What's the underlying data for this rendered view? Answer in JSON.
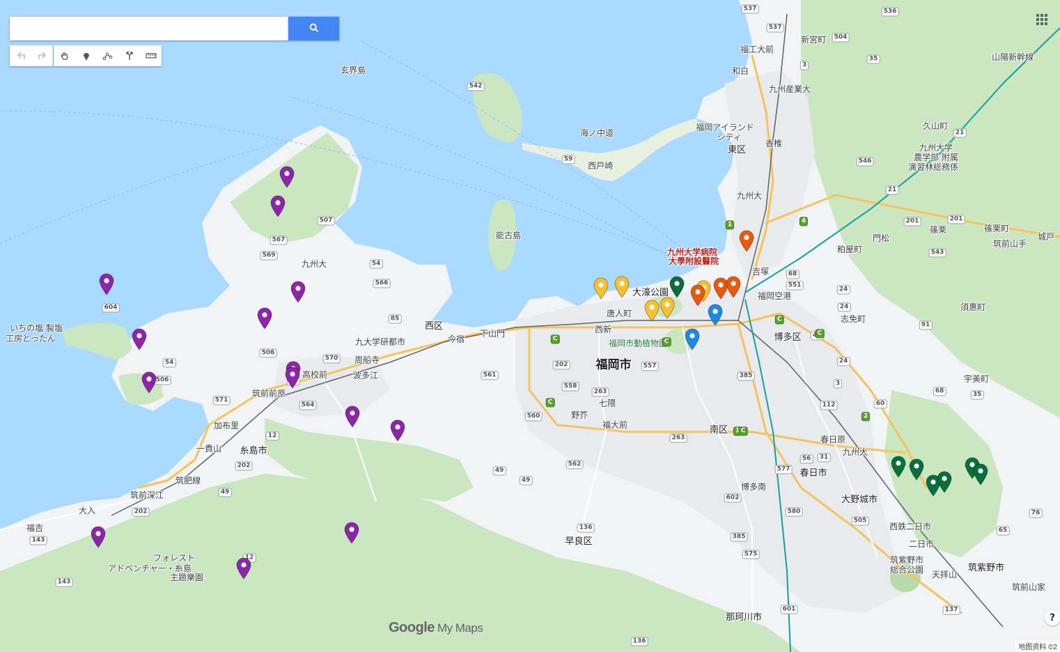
{
  "search": {
    "placeholder": "",
    "value": ""
  },
  "toolbar": {
    "buttons": [
      {
        "id": "undo",
        "icon": "undo-icon"
      },
      {
        "id": "redo",
        "icon": "redo-icon"
      },
      {
        "id": "pan",
        "icon": "hand-icon"
      },
      {
        "id": "marker",
        "icon": "marker-icon"
      },
      {
        "id": "line",
        "icon": "draw-line-icon"
      },
      {
        "id": "directions",
        "icon": "directions-icon"
      },
      {
        "id": "measure",
        "icon": "ruler-icon"
      }
    ]
  },
  "colors": {
    "water": "#aadaff",
    "land": "#f1f3f4",
    "park": "#cbe7c2",
    "forest": "#b8d9a8",
    "purple": "#8e24aa",
    "orange": "#e8590c",
    "yellow": "#fbc02d",
    "green": "#0b6e3d",
    "blue": "#1e88e5",
    "accent": "#4285f4"
  },
  "branding": {
    "google": "Google",
    "mymaps": "My Maps",
    "attribution": "地图资料 ©2"
  },
  "labels": [
    {
      "t": "福岡市",
      "cls": "big"
    },
    {
      "t": "玄界島",
      "cls": ""
    },
    {
      "t": "能古島",
      "cls": ""
    },
    {
      "t": "海ノ中道",
      "cls": ""
    },
    {
      "t": "西戸崎",
      "cls": ""
    },
    {
      "t": "福岡アイランド",
      "cls": ""
    },
    {
      "t": "シティ",
      "cls": ""
    },
    {
      "t": "東区",
      "cls": "mid"
    },
    {
      "t": "香椎",
      "cls": ""
    },
    {
      "t": "新宮町",
      "cls": ""
    },
    {
      "t": "福工大前",
      "cls": ""
    },
    {
      "t": "和白",
      "cls": ""
    },
    {
      "t": "九州産業大",
      "cls": ""
    },
    {
      "t": "九州大",
      "cls": ""
    },
    {
      "t": "九州大学病院",
      "cls": "red"
    },
    {
      "t": "大學附設醫院",
      "cls": "red"
    },
    {
      "t": "吉塚",
      "cls": ""
    },
    {
      "t": "大濠公園",
      "cls": "mid"
    },
    {
      "t": "唐人町",
      "cls": ""
    },
    {
      "t": "西新",
      "cls": ""
    },
    {
      "t": "福岡市動植物園",
      "cls": "green"
    },
    {
      "t": "福岡空港",
      "cls": ""
    },
    {
      "t": "博多区",
      "cls": "mid"
    },
    {
      "t": "粕屋町",
      "cls": ""
    },
    {
      "t": "志免町",
      "cls": ""
    },
    {
      "t": "西区",
      "cls": "mid"
    },
    {
      "t": "九大学研都市",
      "cls": ""
    },
    {
      "t": "今宿",
      "cls": ""
    },
    {
      "t": "下山門",
      "cls": ""
    },
    {
      "t": "周船寺",
      "cls": ""
    },
    {
      "t": "波多江",
      "cls": ""
    },
    {
      "t": "高校前",
      "cls": ""
    },
    {
      "t": "筑前前原",
      "cls": ""
    },
    {
      "t": "加布里",
      "cls": ""
    },
    {
      "t": "一貴山",
      "cls": ""
    },
    {
      "t": "糸島市",
      "cls": "mid"
    },
    {
      "t": "筑肥線",
      "cls": ""
    },
    {
      "t": "筑前深江",
      "cls": ""
    },
    {
      "t": "大入",
      "cls": ""
    },
    {
      "t": "福吉",
      "cls": ""
    },
    {
      "t": "フォレスト",
      "cls": ""
    },
    {
      "t": "アドベンチャー・糸島",
      "cls": ""
    },
    {
      "t": "主題樂園",
      "cls": ""
    },
    {
      "t": "いちの塩 製塩",
      "cls": ""
    },
    {
      "t": "工房とったん",
      "cls": ""
    },
    {
      "t": "七隈",
      "cls": ""
    },
    {
      "t": "野芥",
      "cls": ""
    },
    {
      "t": "福大前",
      "cls": ""
    },
    {
      "t": "南区",
      "cls": "mid"
    },
    {
      "t": "早良区",
      "cls": "mid"
    },
    {
      "t": "博多南",
      "cls": ""
    },
    {
      "t": "春日原",
      "cls": ""
    },
    {
      "t": "春日市",
      "cls": "mid"
    },
    {
      "t": "大野城市",
      "cls": "mid"
    },
    {
      "t": "西鉄二日市",
      "cls": ""
    },
    {
      "t": "二日市",
      "cls": ""
    },
    {
      "t": "筑紫野市",
      "cls": "mid"
    },
    {
      "t": "天拝山",
      "cls": ""
    },
    {
      "t": "筑前山家",
      "cls": ""
    },
    {
      "t": "筑紫野市",
      "cls": ""
    },
    {
      "t": "総合公園",
      "cls": ""
    },
    {
      "t": "那珂川市",
      "cls": "mid"
    },
    {
      "t": "宇美町",
      "cls": ""
    },
    {
      "t": "須惠町",
      "cls": ""
    },
    {
      "t": "篠栗",
      "cls": ""
    },
    {
      "t": "篠栗町",
      "cls": ""
    },
    {
      "t": "門松",
      "cls": ""
    },
    {
      "t": "筑前山手",
      "cls": ""
    },
    {
      "t": "城戸",
      "cls": ""
    },
    {
      "t": "久山町",
      "cls": ""
    },
    {
      "t": "九州大学",
      "cls": ""
    },
    {
      "t": "農学部 附属",
      "cls": ""
    },
    {
      "t": "演習林総務係",
      "cls": ""
    },
    {
      "t": "九州大",
      "cls": ""
    },
    {
      "t": "山陽新幹線",
      "cls": ""
    },
    {
      "t": "九州大",
      "cls": ""
    }
  ],
  "shields": [
    "537",
    "537",
    "536",
    "504",
    "3",
    "35",
    "542",
    "59",
    "507",
    "567",
    "569",
    "54",
    "566",
    "85",
    "604",
    "506",
    "54",
    "506",
    "570",
    "564",
    "571",
    "12",
    "202",
    "49",
    "202",
    "143",
    "143",
    "12",
    "561",
    "202",
    "558",
    "557",
    "560",
    "263",
    "562",
    "49",
    "263",
    "136",
    "56",
    "602",
    "385",
    "575",
    "601",
    "577",
    "580",
    "56",
    "31",
    "505",
    "60",
    "112",
    "2",
    "24",
    "24",
    "24",
    "21",
    "21",
    "201",
    "201",
    "543",
    "91",
    "68",
    "35",
    "76",
    "65",
    "137",
    "136",
    "12",
    "49",
    "3",
    "546",
    "4",
    "385",
    "68",
    "551",
    "45",
    "1",
    "1",
    "C",
    "C",
    "C",
    "C",
    "C",
    "C"
  ],
  "map_markers": [
    {
      "color": "purple",
      "icon": "dot"
    },
    {
      "color": "purple",
      "icon": "dot"
    },
    {
      "color": "purple",
      "icon": "dot"
    },
    {
      "color": "purple",
      "icon": "dot"
    },
    {
      "color": "purple",
      "icon": "dot"
    },
    {
      "color": "purple",
      "icon": "dot"
    },
    {
      "color": "purple",
      "icon": "dot"
    },
    {
      "color": "purple",
      "icon": "dot"
    },
    {
      "color": "purple",
      "icon": "dot"
    },
    {
      "color": "purple",
      "icon": "dot"
    },
    {
      "color": "purple",
      "icon": "dot"
    },
    {
      "color": "purple",
      "icon": "dot"
    },
    {
      "color": "purple",
      "icon": "dot"
    },
    {
      "color": "purple",
      "icon": "dot"
    },
    {
      "color": "yellow",
      "icon": "dot"
    },
    {
      "color": "yellow",
      "icon": "dot"
    },
    {
      "color": "yellow",
      "icon": "dot"
    },
    {
      "color": "yellow",
      "icon": "dot"
    },
    {
      "color": "yellow",
      "icon": "dot"
    },
    {
      "color": "green",
      "icon": "dot"
    },
    {
      "color": "green",
      "icon": "dot"
    },
    {
      "color": "green",
      "icon": "dot"
    },
    {
      "color": "green",
      "icon": "dot"
    },
    {
      "color": "green",
      "icon": "dot"
    },
    {
      "color": "green",
      "icon": "dot"
    },
    {
      "color": "green",
      "icon": "dot"
    },
    {
      "color": "orange",
      "icon": "dot"
    },
    {
      "color": "orange",
      "icon": "dot"
    },
    {
      "color": "orange",
      "icon": "dot"
    },
    {
      "color": "orange",
      "icon": "dot"
    },
    {
      "color": "blue",
      "icon": "dot"
    },
    {
      "color": "blue",
      "icon": "dot"
    }
  ]
}
